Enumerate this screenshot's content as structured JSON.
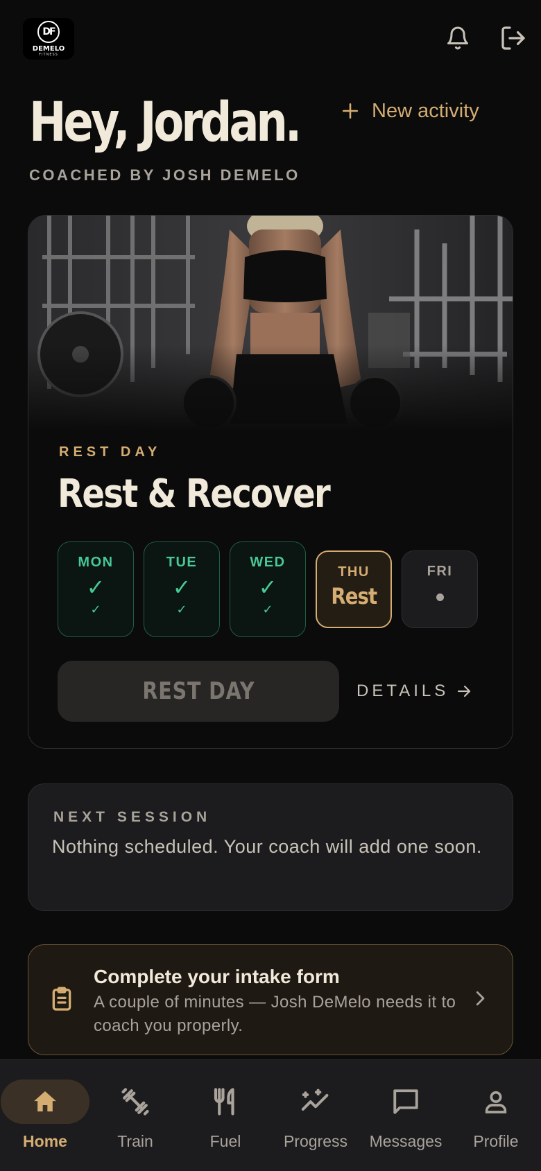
{
  "brand": {
    "logo_mark": "DF",
    "logo_text": "DEMELO",
    "logo_sub": "FITNESS"
  },
  "header": {
    "greeting": "Hey, Jordan.",
    "new_activity_label": "New activity",
    "coached_by": "COACHED BY JOSH DEMELO"
  },
  "today_card": {
    "eyebrow": "REST DAY",
    "title": "Rest & Recover",
    "days": [
      {
        "name": "MON",
        "status": "done",
        "mark": "✓"
      },
      {
        "name": "TUE",
        "status": "done",
        "mark": "✓"
      },
      {
        "name": "WED",
        "status": "done",
        "mark": "✓"
      },
      {
        "name": "THU",
        "status": "today",
        "label": "Rest"
      },
      {
        "name": "FRI",
        "status": "upcoming"
      }
    ],
    "primary_button": "REST DAY",
    "details_label": "DETAILS"
  },
  "next_session": {
    "label": "NEXT SESSION",
    "text": "Nothing scheduled. Your coach will add one soon."
  },
  "intake": {
    "title": "Complete your intake form",
    "text": "A couple of minutes — Josh DeMelo  needs it to coach you properly."
  },
  "nav": [
    {
      "label": "Home",
      "icon": "home-icon",
      "active": true
    },
    {
      "label": "Train",
      "icon": "dumbbell-icon",
      "active": false
    },
    {
      "label": "Fuel",
      "icon": "utensils-icon",
      "active": false
    },
    {
      "label": "Progress",
      "icon": "sparkle-chart-icon",
      "active": false
    },
    {
      "label": "Messages",
      "icon": "message-icon",
      "active": false
    },
    {
      "label": "Profile",
      "icon": "user-icon",
      "active": false
    }
  ],
  "colors": {
    "background": "#0b0b0b",
    "accent_gold": "#d5ad72",
    "success_green": "#48c896",
    "card": "#1c1c1e"
  }
}
